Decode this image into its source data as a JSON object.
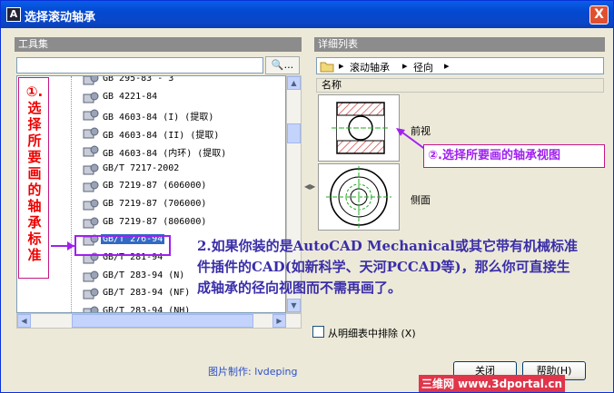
{
  "window": {
    "app_icon": "A",
    "title": "选择滚动轴承",
    "close_glyph": "X"
  },
  "left_pane": {
    "header": "工具集",
    "search_placeholder": "",
    "search_button": "🔍...",
    "tree_items": [
      {
        "label": "GB 295-83 - 3",
        "selected": false
      },
      {
        "label": "GB 4221-84",
        "selected": false
      },
      {
        "label": "GB 4603-84 (I) (提取)",
        "selected": false
      },
      {
        "label": "GB 4603-84 (II) (提取)",
        "selected": false
      },
      {
        "label": "GB 4603-84 (内环) (提取)",
        "selected": false
      },
      {
        "label": "GB/T 7217-2002",
        "selected": false
      },
      {
        "label": "GB 7219-87 (606000)",
        "selected": false
      },
      {
        "label": "GB 7219-87 (706000)",
        "selected": false
      },
      {
        "label": "GB 7219-87 (806000)",
        "selected": false
      },
      {
        "label": "GB/T 276-94",
        "selected": true
      },
      {
        "label": "GB/T 281-94",
        "selected": false
      },
      {
        "label": "GB/T 283-94 (N)",
        "selected": false
      },
      {
        "label": "GB/T 283-94 (NF)",
        "selected": false
      },
      {
        "label": "GB/T 283-94 (NH)",
        "selected": false
      }
    ]
  },
  "annotation_left": "①.选择所要画的轴承标准",
  "right_pane": {
    "header": "详细列表",
    "breadcrumb": [
      "滚动轴承",
      "径向"
    ],
    "column_header": "名称",
    "views": [
      {
        "label": "前视"
      },
      {
        "label": "侧面"
      }
    ]
  },
  "annotation_right": "②.选择所要画的轴承视图",
  "annotation_main": "2.如果你装的是AutoCAD Mechanical或其它带有机械标准件插件的CAD(如新科学、天河PCCAD等)，那么你可直接生成轴承的径向视图而不需再画了。",
  "exclude_checkbox": {
    "label": "从明细表中排除 (X)",
    "checked": false
  },
  "credit": "图片制作: lvdeping",
  "buttons": {
    "close": "关闭",
    "help": "帮助(H)"
  },
  "watermark": "三维网 www.3dportal.cn",
  "colors": {
    "titlebar": "#0348d0",
    "selection": "#316ac5",
    "annotation_red": "#e00000",
    "annotation_purple": "#a020f0",
    "main_text": "#3a2ea8"
  }
}
